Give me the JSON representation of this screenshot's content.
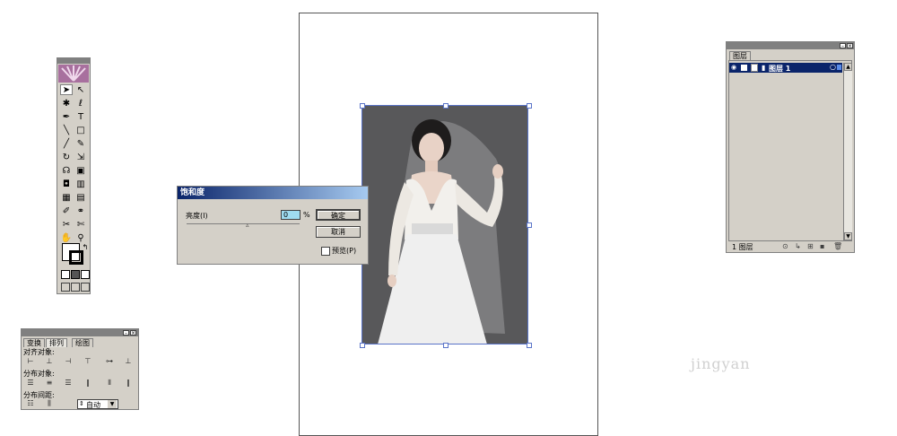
{
  "saturation_dialog": {
    "title": "饱和度",
    "brightness_label": "亮度(I)",
    "value": "0",
    "unit": "%",
    "ok_label": "确定",
    "cancel_label": "取消",
    "preview_label": "预览(P)"
  },
  "layers_panel": {
    "tab_label": "图层",
    "layer_name": "图层 1",
    "footer_count": "1 图层"
  },
  "align_panel": {
    "tabs": [
      "变换",
      "排列",
      "绘图"
    ],
    "align_objects_label": "对齐对象:",
    "distribute_objects_label": "分布对象:",
    "distribute_spacing_label": "分布间距:",
    "spacing_value": "自动"
  },
  "watermark": "jingyan"
}
